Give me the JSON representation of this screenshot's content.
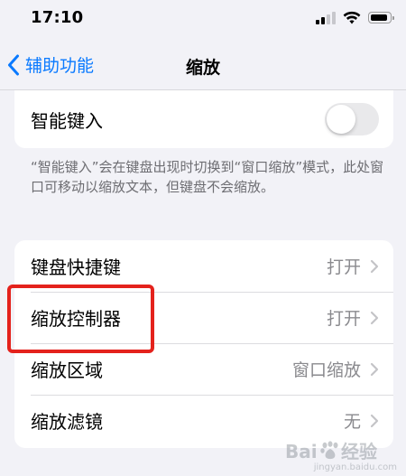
{
  "status_bar": {
    "time": "17:10",
    "battery_level": 0.9
  },
  "nav": {
    "back_label": "辅助功能",
    "title": "缩放"
  },
  "smart_typing": {
    "label": "智能键入",
    "enabled": false
  },
  "footer_note": "“智能键入”会在键盘出现时切换到“窗口缩放”模式，此处窗口可移动以缩放文本，但键盘不会缩放。",
  "settings": [
    {
      "label": "键盘快捷键",
      "value": "打开"
    },
    {
      "label": "缩放控制器",
      "value": "打开",
      "highlighted": true
    },
    {
      "label": "缩放区域",
      "value": "窗口缩放"
    },
    {
      "label": "缩放滤镜",
      "value": "无"
    }
  ],
  "colors": {
    "accent": "#0a7aff",
    "highlight": "#e4221c",
    "background": "#f2f2f7"
  },
  "watermark": {
    "brand": "Baidu经验",
    "url": "jingyan.baidu.com"
  }
}
